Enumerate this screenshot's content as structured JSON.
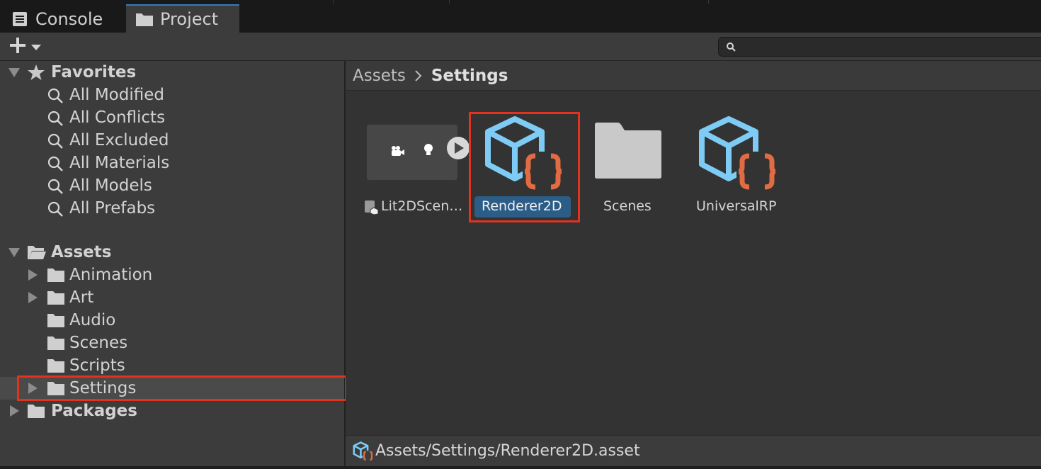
{
  "tabs": [
    {
      "label": "Console",
      "icon": "console-icon",
      "active": false
    },
    {
      "label": "Project",
      "icon": "folder-icon",
      "active": true
    }
  ],
  "toolbar": {
    "create_icon": "plus-icon",
    "search_value": "",
    "search_placeholder": ""
  },
  "favorites": {
    "label": "Favorites",
    "items": [
      "All Modified",
      "All Conflicts",
      "All Excluded",
      "All Materials",
      "All Models",
      "All Prefabs"
    ]
  },
  "assets": {
    "label": "Assets",
    "children": [
      {
        "label": "Animation",
        "expandable": true
      },
      {
        "label": "Art",
        "expandable": true
      },
      {
        "label": "Audio",
        "expandable": false
      },
      {
        "label": "Scenes",
        "expandable": false
      },
      {
        "label": "Scripts",
        "expandable": false
      },
      {
        "label": "Settings",
        "expandable": true,
        "selected": true
      }
    ]
  },
  "packages": {
    "label": "Packages"
  },
  "breadcrumb": {
    "root": "Assets",
    "current": "Settings"
  },
  "grid_items": [
    {
      "label": "Lit2DScen…",
      "kind": "scene-template",
      "selected": false
    },
    {
      "label": "Renderer2D",
      "kind": "scriptable-asset",
      "selected": true
    },
    {
      "label": "Scenes",
      "kind": "folder",
      "selected": false
    },
    {
      "label": "UniversalRP",
      "kind": "scriptable-asset",
      "selected": false
    }
  ],
  "status": {
    "path": "Assets/Settings/Renderer2D.asset"
  },
  "colors": {
    "selection_blue": "#2c5d87",
    "asset_icon_blue": "#7ecbf5",
    "asset_icon_orange": "#e16c44",
    "highlight_red": "#e2331f",
    "tab_accent": "#3a79bb"
  }
}
